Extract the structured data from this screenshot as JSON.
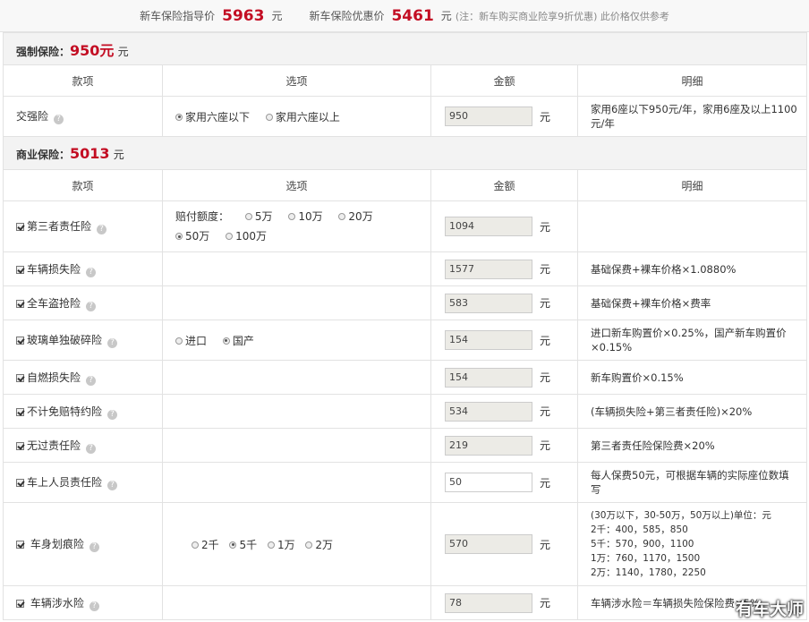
{
  "header": {
    "guide_label": "新车保险指导价",
    "guide_value": "5963",
    "guide_unit": "元",
    "discount_label": "新车保险优惠价",
    "discount_value": "5461",
    "discount_unit": "元",
    "note": "(注：新车购买商业险享9折优惠) 此价格仅供参考"
  },
  "compulsory": {
    "label": "强制保险：",
    "amount": "950元",
    "unit": "元",
    "columns": [
      "款项",
      "选项",
      "金额",
      "明细"
    ],
    "row": {
      "name": "交强险",
      "options": [
        "家用六座以下",
        "家用六座以上"
      ],
      "selected": 0,
      "value": "950",
      "unit": "元",
      "detail": "家用6座以下950元/年，家用6座及以上1100元/年"
    }
  },
  "commercial": {
    "label": "商业保险：",
    "amount": "5013",
    "unit": "元",
    "columns": [
      "款项",
      "选项",
      "金额",
      "明细"
    ],
    "rows": [
      {
        "name": "第三者责任险",
        "options_label": "赔付额度：",
        "options": [
          "5万",
          "10万",
          "20万",
          "50万",
          "100万"
        ],
        "selected": 3,
        "value": "1094",
        "unit": "元",
        "detail": ""
      },
      {
        "name": "车辆损失险",
        "value": "1577",
        "unit": "元",
        "detail": "基础保费+裸车价格×1.0880%"
      },
      {
        "name": "全车盗抢险",
        "value": "583",
        "unit": "元",
        "detail": "基础保费+裸车价格×费率"
      },
      {
        "name": "玻璃单独破碎险",
        "options": [
          "进口",
          "国产"
        ],
        "selected": 1,
        "value": "154",
        "unit": "元",
        "detail": "进口新车购置价×0.25%，国产新车购置价×0.15%"
      },
      {
        "name": "自燃损失险",
        "value": "154",
        "unit": "元",
        "detail": "新车购置价×0.15%"
      },
      {
        "name": "不计免赔特约险",
        "value": "534",
        "unit": "元",
        "detail": "(车辆损失险+第三者责任险)×20%"
      },
      {
        "name": "无过责任险",
        "value": "219",
        "unit": "元",
        "detail": "第三者责任险保险费×20%"
      },
      {
        "name": "车上人员责任险",
        "value": "50",
        "unit": "元",
        "detail": "每人保费50元，可根据车辆的实际座位数填写"
      },
      {
        "name": "车身划痕险",
        "options": [
          "2千",
          "5千",
          "1万",
          "2万"
        ],
        "selected": 1,
        "value": "570",
        "unit": "元",
        "detail_lines": [
          "(30万以下，30-50万，50万以上)单位：元",
          "2千：400，585，850",
          "5千：570，900，1100",
          "1万：760，1170，1500",
          "2万：1140，1780，2250"
        ]
      },
      {
        "name": "车辆涉水险",
        "value": "78",
        "unit": "元",
        "detail": "车辆涉水险＝车辆损失险保险费×5%"
      }
    ]
  },
  "watermark": "有车大师"
}
